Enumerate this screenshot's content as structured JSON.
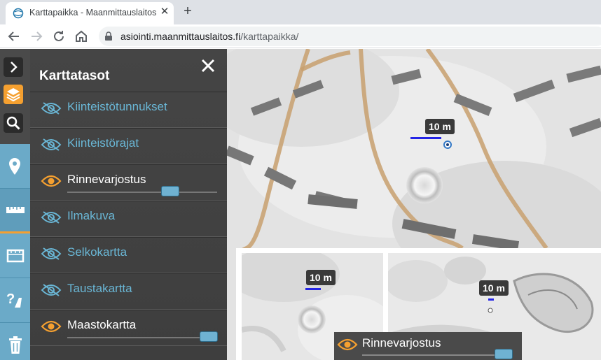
{
  "browser": {
    "tab_title": "Karttapaikka - Maanmittauslaitos",
    "url_host": "asiointi.maanmittauslaitos.fi",
    "url_path": "/karttapaikka/"
  },
  "panel": {
    "title": "Karttatasot",
    "layers": [
      {
        "label": "Kiinteistötunnukset",
        "visible": false,
        "opacity": null
      },
      {
        "label": "Kiinteistörajat",
        "visible": false,
        "opacity": null
      },
      {
        "label": "Rinnevarjostus",
        "visible": true,
        "opacity": 0.8
      },
      {
        "label": "Ilmakuva",
        "visible": false,
        "opacity": null
      },
      {
        "label": "Selkokartta",
        "visible": false,
        "opacity": null
      },
      {
        "label": "Taustakartta",
        "visible": false,
        "opacity": null
      },
      {
        "label": "Maastokartta",
        "visible": true,
        "opacity": 0.95
      }
    ]
  },
  "map": {
    "scale_main": "10 m",
    "scale_inset_left": "10 m",
    "scale_inset_right": "10 m"
  },
  "inset_panel": {
    "label": "Rinnevarjostus",
    "opacity": 0.95
  },
  "icons": {
    "rail": [
      "chevron-right-icon",
      "layers-icon",
      "search-icon",
      "location-pin-icon",
      "ruler-icon",
      "area-measure-icon",
      "help-icon",
      "trash-icon"
    ]
  },
  "colors": {
    "accent_orange": "#f5a030",
    "accent_blue": "#6ab7d6",
    "panel_bg": "#454545"
  }
}
